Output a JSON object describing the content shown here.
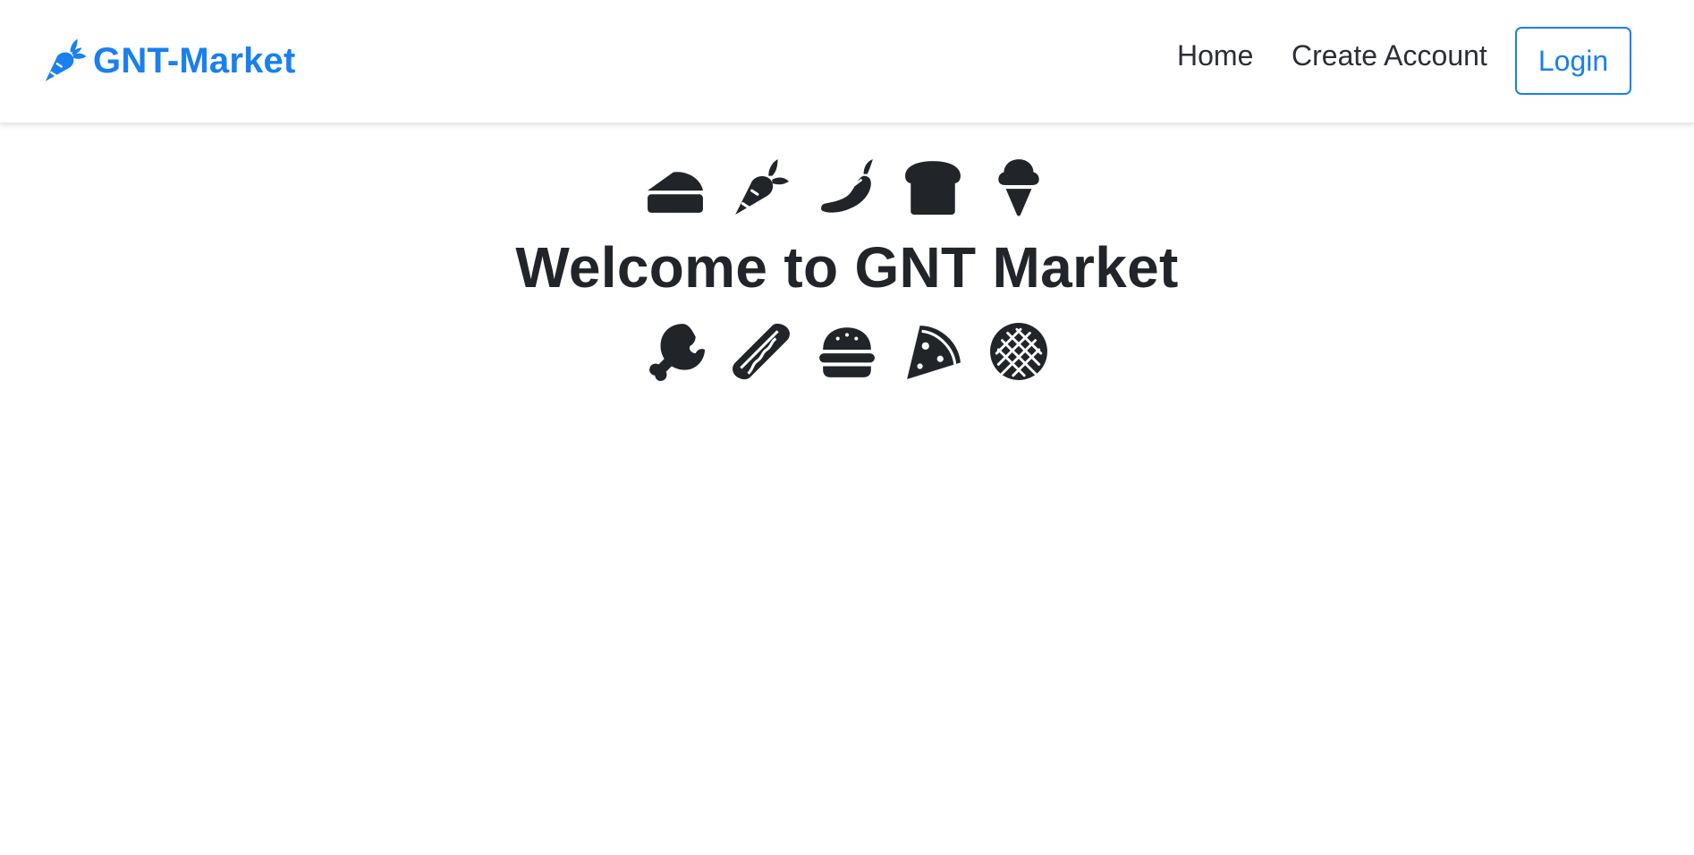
{
  "navbar": {
    "brand_text": "GNT-Market",
    "brand_icon": "carrot-icon",
    "links": [
      {
        "label": "Home"
      },
      {
        "label": "Create Account"
      }
    ],
    "login_label": "Login"
  },
  "hero": {
    "title": "Welcome to GNT Market",
    "top_icons": [
      "cheese-icon",
      "carrot-icon",
      "pepper-icon",
      "bread-icon",
      "ice-cream-icon"
    ],
    "bottom_icons": [
      "drumstick-icon",
      "hotdog-icon",
      "hamburger-icon",
      "pizza-icon",
      "cookie-icon"
    ]
  },
  "colors": {
    "accent": "#1a7ff0",
    "text": "#212529",
    "background": "#ffffff"
  }
}
